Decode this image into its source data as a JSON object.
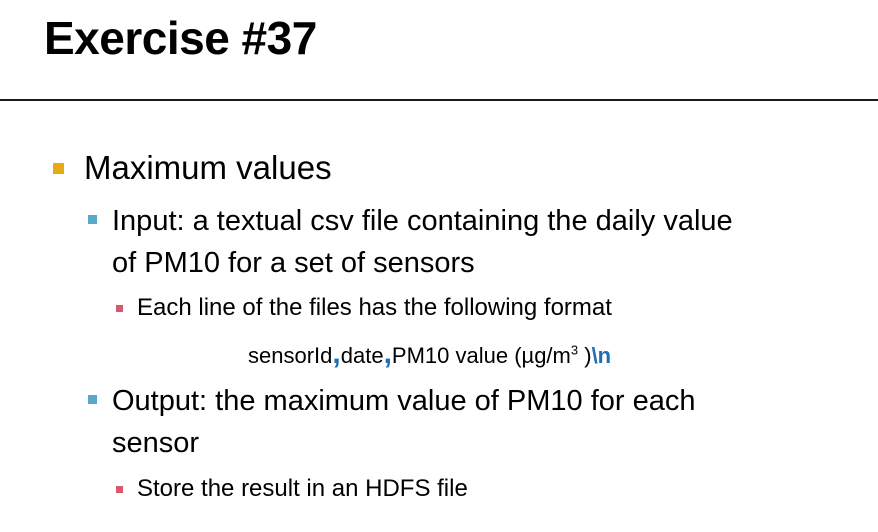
{
  "title": "Exercise #37",
  "bullets": {
    "heading": "Maximum values",
    "input_line1": "Input: a textual csv file containing the daily value",
    "input_line2": "of PM10 for a set of sensors",
    "format_note": "Each line of the files has the following format",
    "format": {
      "field1": "sensorId",
      "sep": ",",
      "field2": "date",
      "field3": "PM10 value (µg/m",
      "unit_exp": "3",
      "field3_end": " )",
      "newline": "\\n"
    },
    "output_line1": "Output: the maximum value of PM10 for each",
    "output_line2": "sensor",
    "store_note": "Store the result in an HDFS file"
  },
  "colors": {
    "level1_bullet": "#e8a917",
    "level2_bullet": "#5aa8c9",
    "level3_bullet": "#d65a6f",
    "separator": "#1f6fb3"
  }
}
